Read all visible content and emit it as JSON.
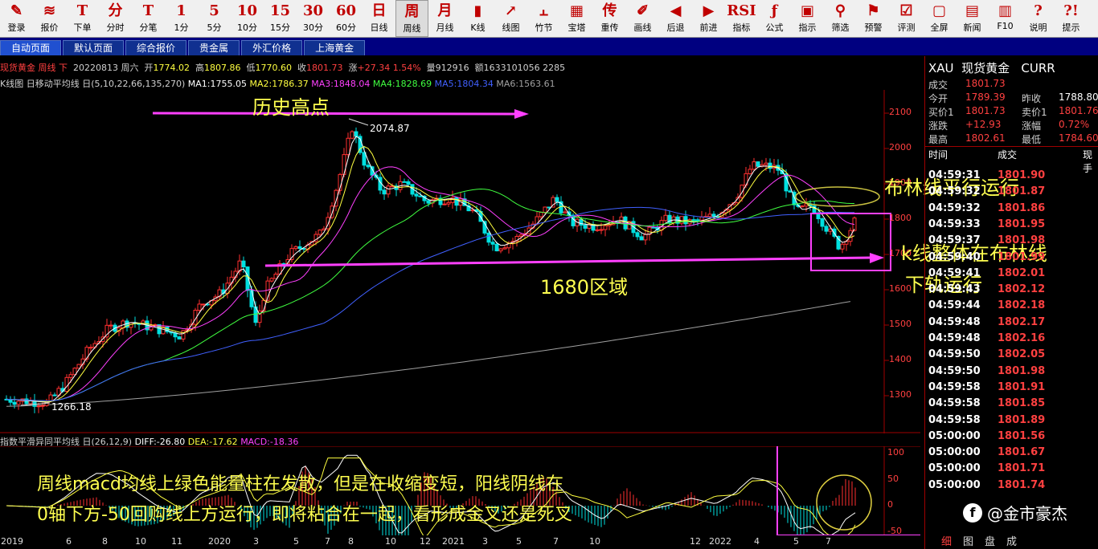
{
  "toolbar": [
    {
      "icon": "✎",
      "label": "登录"
    },
    {
      "icon": "≋",
      "label": "报价"
    },
    {
      "icon": "T",
      "label": "下单"
    },
    {
      "icon": "分",
      "label": "分时"
    },
    {
      "icon": "T",
      "label": "分笔"
    },
    {
      "icon": "1",
      "label": "1分"
    },
    {
      "icon": "5",
      "label": "5分"
    },
    {
      "icon": "10",
      "label": "10分"
    },
    {
      "icon": "15",
      "label": "15分"
    },
    {
      "icon": "30",
      "label": "30分"
    },
    {
      "icon": "60",
      "label": "60分"
    },
    {
      "icon": "日",
      "label": "日线"
    },
    {
      "icon": "周",
      "label": "周线",
      "active": true
    },
    {
      "icon": "月",
      "label": "月线"
    },
    {
      "icon": "▮",
      "label": "K线"
    },
    {
      "icon": "↗",
      "label": "线图"
    },
    {
      "icon": "⫠",
      "label": "竹节"
    },
    {
      "icon": "▦",
      "label": "宝塔"
    },
    {
      "icon": "传",
      "label": "重传"
    },
    {
      "icon": "✐",
      "label": "画线"
    },
    {
      "icon": "◀",
      "label": "后退"
    },
    {
      "icon": "▶",
      "label": "前进"
    },
    {
      "icon": "RSI",
      "label": "指标"
    },
    {
      "icon": "ƒ",
      "label": "公式"
    },
    {
      "icon": "▣",
      "label": "指示"
    },
    {
      "icon": "⚲",
      "label": "筛选"
    },
    {
      "icon": "⚑",
      "label": "预警"
    },
    {
      "icon": "☑",
      "label": "评测"
    },
    {
      "icon": "▢",
      "label": "全屏"
    },
    {
      "icon": "▤",
      "label": "新闻"
    },
    {
      "icon": "▥",
      "label": "F10"
    },
    {
      "icon": "?",
      "label": "说明"
    },
    {
      "icon": "?!",
      "label": "提示"
    }
  ],
  "tabs": [
    "自动页面",
    "默认页面",
    "综合报价",
    "贵金属",
    "外汇价格",
    "上海黄金"
  ],
  "info": {
    "name": "现货黄金 周线 下",
    "date": "20220813 周六",
    "open_label": "开",
    "open": "1774.02",
    "high_label": "高",
    "high": "1807.86",
    "low_label": "低",
    "low": "1770.60",
    "close_label": "收",
    "close": "1801.73",
    "chg_label": "涨",
    "chg": "+27.34 1.54%",
    "vol_label": "量",
    "vol": "912916",
    "amt_label": "额",
    "amt": "1633101056 2285"
  },
  "ma": {
    "title": "K线图 日移动平均线 日(5,10,22,66,135,270)",
    "ma1": "MA1:1755.05",
    "ma2": "MA2:1786.37",
    "ma3": "MA3:1848.04",
    "ma4": "MA4:1828.69",
    "ma5": "MA5:1804.34",
    "ma6": "MA6:1563.61"
  },
  "macd": {
    "title": "指数平滑异同平均线 日(26,12,9)",
    "diff": "DIFF:-26.80",
    "dea": "DEA:-17.62",
    "macd": "MACD:-18.36"
  },
  "price_axis": [
    "2100",
    "2000",
    "1900",
    "1800",
    "1700",
    "1600",
    "1500",
    "1400",
    "1300"
  ],
  "macd_axis": [
    "100",
    "50",
    "0",
    "-50"
  ],
  "x_axis": [
    {
      "t": "2019",
      "p": 0.001
    },
    {
      "t": "6",
      "p": 0.072
    },
    {
      "t": "8",
      "p": 0.111
    },
    {
      "t": "10",
      "p": 0.147
    },
    {
      "t": "11",
      "p": 0.186
    },
    {
      "t": "2020",
      "p": 0.226
    },
    {
      "t": "3",
      "p": 0.275
    },
    {
      "t": "5",
      "p": 0.319
    },
    {
      "t": "7",
      "p": 0.353
    },
    {
      "t": "8",
      "p": 0.378
    },
    {
      "t": "10",
      "p": 0.418
    },
    {
      "t": "12",
      "p": 0.456
    },
    {
      "t": "2021",
      "p": 0.48
    },
    {
      "t": "3",
      "p": 0.524
    },
    {
      "t": "5",
      "p": 0.561
    },
    {
      "t": "7",
      "p": 0.601
    },
    {
      "t": "10",
      "p": 0.64
    },
    {
      "t": "12",
      "p": 0.749
    },
    {
      "t": "2022",
      "p": 0.77
    },
    {
      "t": "4",
      "p": 0.819
    },
    {
      "t": "5",
      "p": 0.862
    },
    {
      "t": "7",
      "p": 0.897
    }
  ],
  "annotations": {
    "hist_high": "历史高点",
    "high_value": "2074.87",
    "low_value": "1266.18",
    "zone": "1680区域",
    "boll1": "布林线平行运行",
    "kline1": "k线整体在布林线",
    "kline2": "下轨运行",
    "macd1": "周线macd均线上绿色能量柱在发散，但是在收缩变短，阳线阴线在",
    "macd2": "0轴下方-50回购线上方运行，即将粘合在一起，看形成金叉还是死叉"
  },
  "quote": {
    "symbol": "XAU",
    "name": "现货黄金",
    "currency": "CURR",
    "last_label": "成交",
    "last": "1801.73",
    "open_label": "今开",
    "open": "1789.39",
    "prev_label": "昨收",
    "prev": "1788.80",
    "bid_label": "买价1",
    "bid": "1801.73",
    "ask_label": "卖价1",
    "ask": "1801.76",
    "chg_label": "涨跌",
    "chg": "+12.93",
    "pct_label": "涨幅",
    "pct": "0.72%",
    "high_label": "最高",
    "high": "1802.61",
    "low_label": "最低",
    "low": "1784.60"
  },
  "ticks_header": {
    "time": "时间",
    "price": "成交",
    "now": "现手"
  },
  "ticks": [
    {
      "t": "04:59:31",
      "p": "1801.90"
    },
    {
      "t": "04:59:32",
      "p": "1801.87"
    },
    {
      "t": "04:59:32",
      "p": "1801.86"
    },
    {
      "t": "04:59:33",
      "p": "1801.95"
    },
    {
      "t": "04:59:37",
      "p": "1801.98"
    },
    {
      "t": "04:59:40",
      "p": "1801.99"
    },
    {
      "t": "04:59:41",
      "p": "1802.01"
    },
    {
      "t": "04:59:43",
      "p": "1802.12"
    },
    {
      "t": "04:59:44",
      "p": "1802.18"
    },
    {
      "t": "04:59:48",
      "p": "1802.17"
    },
    {
      "t": "04:59:48",
      "p": "1802.16"
    },
    {
      "t": "04:59:50",
      "p": "1802.05"
    },
    {
      "t": "04:59:50",
      "p": "1801.98"
    },
    {
      "t": "04:59:58",
      "p": "1801.91"
    },
    {
      "t": "04:59:58",
      "p": "1801.85"
    },
    {
      "t": "04:59:58",
      "p": "1801.89"
    },
    {
      "t": "05:00:00",
      "p": "1801.56"
    },
    {
      "t": "05:00:00",
      "p": "1801.67"
    },
    {
      "t": "05:00:00",
      "p": "1801.71"
    },
    {
      "t": "05:00:00",
      "p": "1801.74"
    }
  ],
  "bottom_tabs": [
    "细",
    "图",
    "盘",
    "成"
  ],
  "watermark": {
    "logo": "f",
    "text": "@金市豪杰"
  },
  "colors": {
    "up": "#ff3030",
    "down": "#00e0e0",
    "ma1": "#ffffff",
    "ma2": "#ffff40",
    "ma3": "#ff40ff",
    "ma4": "#40ff40",
    "ma5": "#4060ff",
    "ma6": "#a0a0a0",
    "annot": "#ff40ff",
    "text_yellow": "#ffff50"
  }
}
